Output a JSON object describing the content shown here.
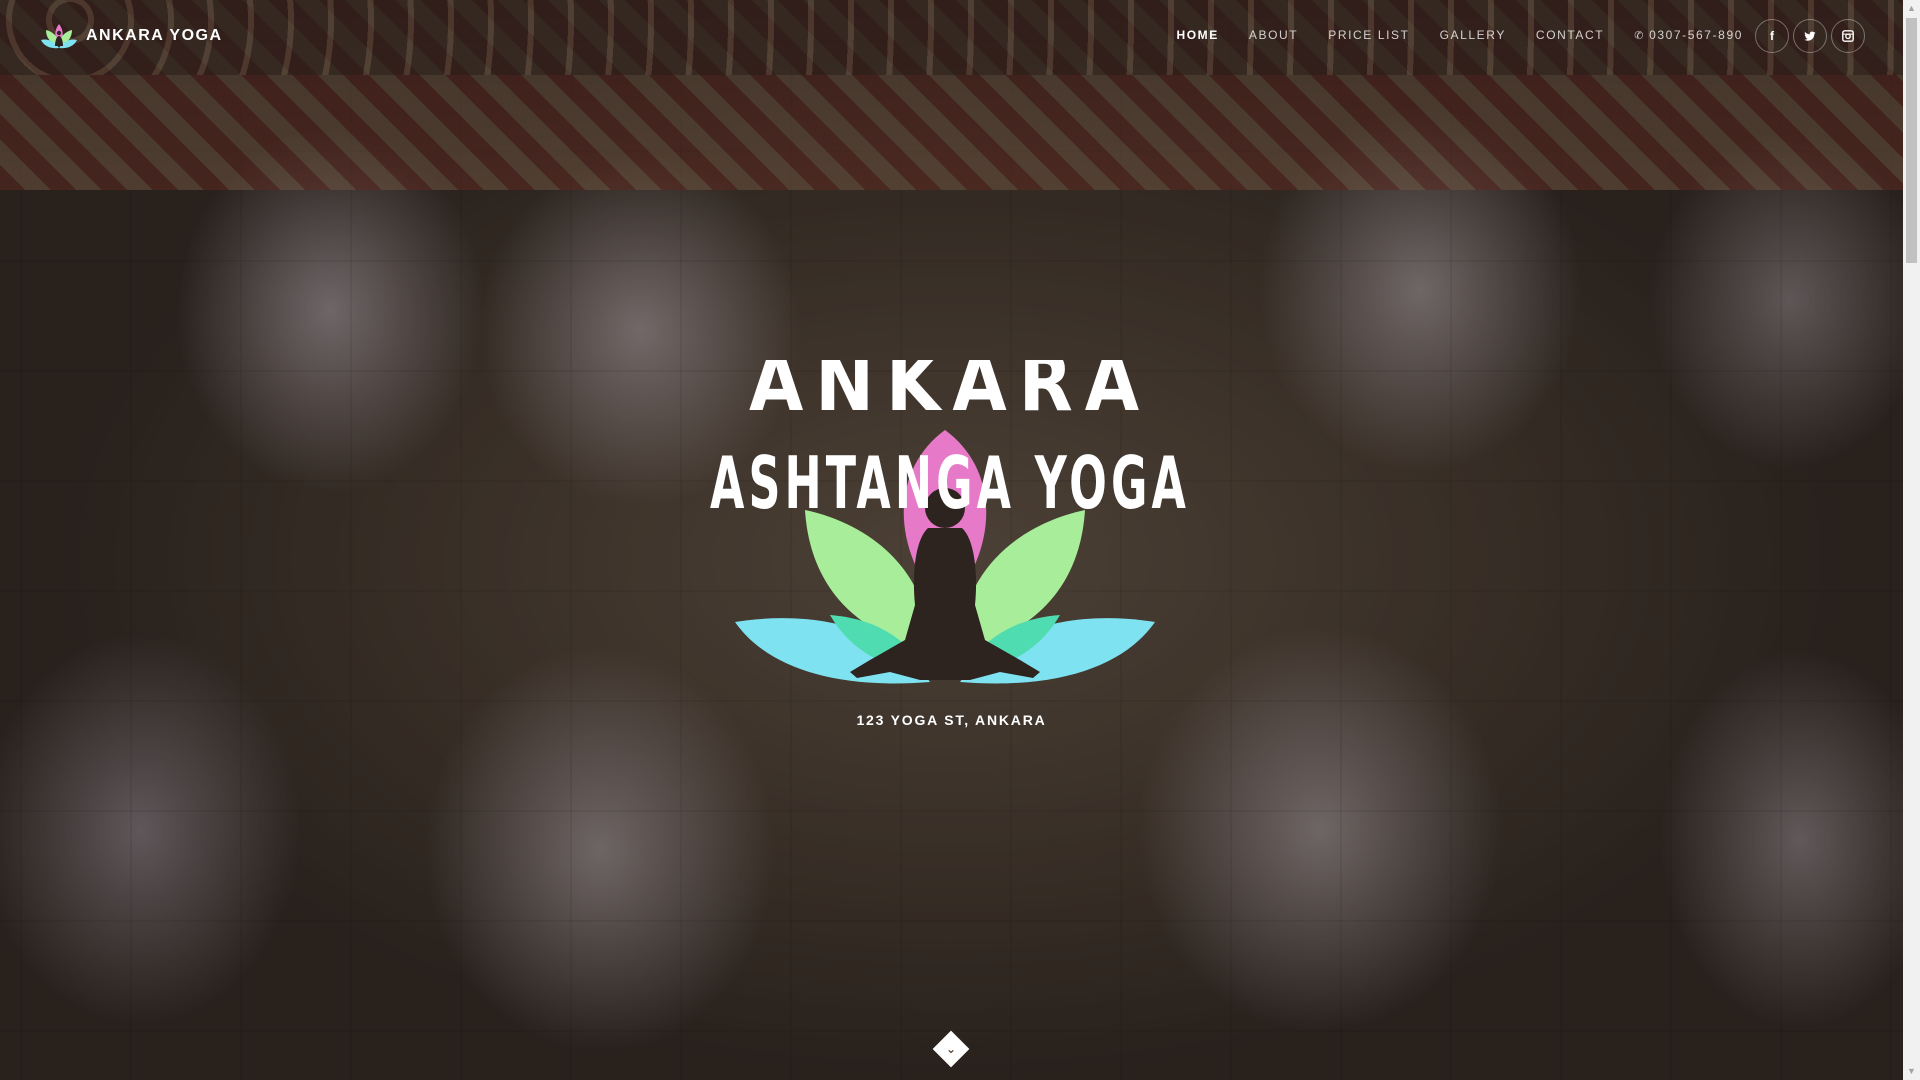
{
  "brand": {
    "name": "ANKARA YOGA",
    "logo_icon": "lotus-icon",
    "colors": {
      "pink": "#e779c9",
      "green": "#a8ee9a",
      "blue": "#7ee2f0",
      "teal": "#4fdcb0"
    }
  },
  "nav": {
    "items": [
      {
        "label": "HOME",
        "active": true
      },
      {
        "label": "ABOUT",
        "active": false
      },
      {
        "label": "PRICE LIST",
        "active": false
      },
      {
        "label": "GALLERY",
        "active": false
      },
      {
        "label": "CONTACT",
        "active": false
      }
    ],
    "phone": {
      "icon": "phone-icon",
      "label": "0307-567-890"
    }
  },
  "socials": [
    {
      "icon": "facebook-icon",
      "glyph": "f"
    },
    {
      "icon": "twitter-icon",
      "glyph": "t"
    },
    {
      "icon": "instagram-icon",
      "glyph": "◎"
    }
  ],
  "hero": {
    "title_line1": "ANKARA",
    "title_line2": "ASHTANGA YOGA",
    "address": "123 YOGA ST, ANKARA",
    "scroll_icon": "chevron-down-icon"
  }
}
